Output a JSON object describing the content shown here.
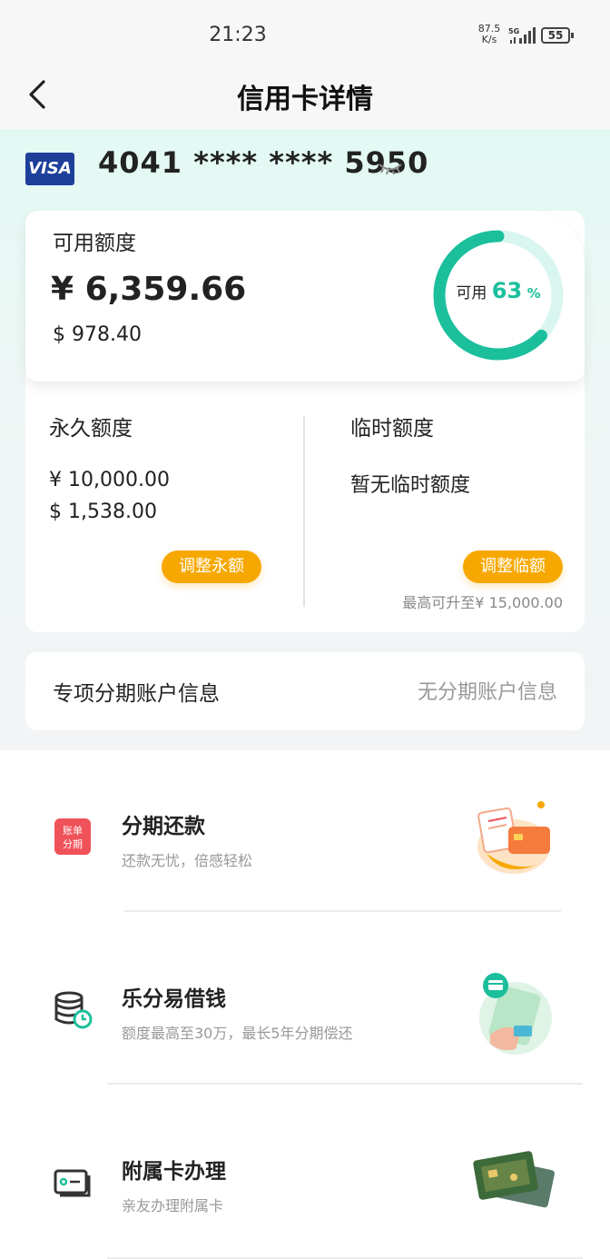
{
  "status_bar": {
    "time": "21:23",
    "net_speed": "87.5",
    "net_unit": "K/s",
    "signal": "5G",
    "battery": "55"
  },
  "nav": {
    "title": "信用卡详情",
    "back_icon": "chevron-left-icon"
  },
  "card": {
    "brand": "VISA",
    "number": "4041 **** **** 5950",
    "visibility_icon": "eye-closed-icon"
  },
  "available": {
    "label": "可用额度",
    "cny": "¥ 6,359.66",
    "usd": "$ 978.40",
    "ring_label": "可用",
    "ring_percent": "63",
    "ring_percent_sign": "%",
    "ring_fraction": 0.63,
    "ring_color": "#1bbf9c",
    "ring_track_color": "#d8f6ef"
  },
  "permanent": {
    "title": "永久额度",
    "cny": "¥ 10,000.00",
    "usd": "$ 1,538.00",
    "button": "调整永额"
  },
  "temporary": {
    "title": "临时额度",
    "value": "暂无临时额度",
    "button": "调整临额",
    "max_note": "最高可升至¥ 15,000.00"
  },
  "installment_account": {
    "label": "专项分期账户信息",
    "value": "无分期账户信息"
  },
  "services": [
    {
      "title": "分期还款",
      "subtitle": "还款无忧，倍感轻松",
      "icon": "bill-installment-icon",
      "art": "card-payment-illustration",
      "icon_text": [
        "账单",
        "分期"
      ]
    },
    {
      "title": "乐分易借钱",
      "subtitle": "额度最高至30万，最长5年分期偿还",
      "icon": "coin-stack-clock-icon",
      "art": "phone-loan-illustration"
    },
    {
      "title": "附属卡办理",
      "subtitle": "亲友办理附属卡",
      "icon": "card-icon",
      "art": "cards-illustration"
    }
  ],
  "accent_color": "#f7a800"
}
